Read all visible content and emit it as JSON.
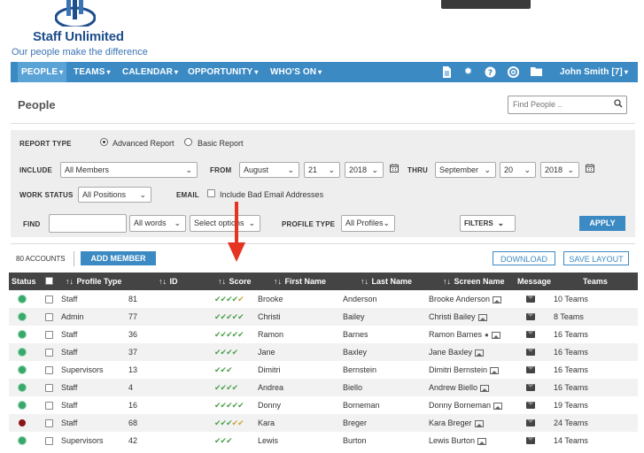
{
  "header": {
    "brand": "Staff Unlimited",
    "tagline": "Our people make the difference"
  },
  "nav": {
    "items": [
      {
        "label": "PEOPLE"
      },
      {
        "label": "TEAMS"
      },
      {
        "label": "CALENDAR"
      },
      {
        "label": "OPPORTUNITY"
      },
      {
        "label": "WHO'S ON"
      }
    ],
    "icons": [
      "document-icon",
      "gear-icon",
      "help-icon",
      "support-icon",
      "folder-icon"
    ],
    "user_label": "John Smith [7]"
  },
  "page": {
    "title": "People",
    "find_placeholder": "Find People .."
  },
  "filters": {
    "report_type_label": "REPORT TYPE",
    "advanced_report": "Advanced Report",
    "basic_report": "Basic Report",
    "include_label": "INCLUDE",
    "include_value": "All Members",
    "from_label": "FROM",
    "from_month": "August",
    "from_day": "21",
    "from_year": "2018",
    "thru_label": "THRU",
    "thru_month": "September",
    "thru_day": "20",
    "thru_year": "2018",
    "work_status_label": "WORK STATUS",
    "work_status_value": "All Positions",
    "email_label": "EMAIL",
    "bad_email_label": "Include Bad Email Addresses",
    "find_label": "FIND",
    "words_value": "All words",
    "options_value": "Select options",
    "profile_type_label": "PROFILE TYPE",
    "profile_type_value": "All Profiles",
    "filters_button": "FILTERS",
    "apply_button": "APPLY"
  },
  "actions": {
    "accounts": "80 ACCOUNTS",
    "add_member": "ADD MEMBER",
    "download": "DOWNLOAD",
    "save_layout": "SAVE LAYOUT"
  },
  "table": {
    "headers": {
      "status": "Status",
      "profile_type": "Profile Type",
      "id": "ID",
      "score": "Score",
      "first_name": "First Name",
      "last_name": "Last Name",
      "screen_name": "Screen Name",
      "message": "Message",
      "teams": "Teams"
    },
    "sort_glyph": "↑↓",
    "rows": [
      {
        "status": "green",
        "profile": "Staff",
        "id": "81",
        "score_green": "✔✔✔✔",
        "score_yellow": "✔",
        "first": "Brooke",
        "last": "Anderson",
        "screen": "Brooke Anderson",
        "person": false,
        "teams": "10 Teams"
      },
      {
        "status": "green",
        "profile": "Admin",
        "id": "77",
        "score_green": "✔✔✔✔✔",
        "score_yellow": "",
        "first": "Christi",
        "last": "Bailey",
        "screen": "Christi Bailey",
        "person": false,
        "teams": "8 Teams"
      },
      {
        "status": "green",
        "profile": "Staff",
        "id": "36",
        "score_green": "✔✔✔✔✔",
        "score_yellow": "",
        "first": "Ramon",
        "last": "Barnes",
        "screen": "Ramon Barnes",
        "person": true,
        "teams": "16 Teams"
      },
      {
        "status": "green",
        "profile": "Staff",
        "id": "37",
        "score_green": "✔✔✔✔",
        "score_yellow": "",
        "first": "Jane",
        "last": "Baxley",
        "screen": "Jane Baxley",
        "person": false,
        "teams": "16 Teams"
      },
      {
        "status": "green",
        "profile": "Supervisors",
        "id": "13",
        "score_green": "✔✔✔",
        "score_yellow": "",
        "first": "Dimitri",
        "last": "Bernstein",
        "screen": "Dimitri Bernstein",
        "person": false,
        "teams": "16 Teams"
      },
      {
        "status": "green",
        "profile": "Staff",
        "id": "4",
        "score_green": "✔✔✔✔",
        "score_yellow": "",
        "first": "Andrea",
        "last": "Biello",
        "screen": "Andrew Biello",
        "person": false,
        "teams": "16 Teams"
      },
      {
        "status": "green",
        "profile": "Staff",
        "id": "16",
        "score_green": "✔✔✔✔✔",
        "score_yellow": "",
        "first": "Donny",
        "last": "Borneman",
        "screen": "Donny Borneman",
        "person": false,
        "teams": "19 Teams"
      },
      {
        "status": "red",
        "profile": "Staff",
        "id": "68",
        "score_green": "✔✔✔",
        "score_yellow": "✔✔",
        "first": "Kara",
        "last": "Breger",
        "screen": "Kara Breger",
        "person": false,
        "teams": "24 Teams"
      },
      {
        "status": "green",
        "profile": "Supervisors",
        "id": "42",
        "score_green": "✔✔✔",
        "score_yellow": "",
        "first": "Lewis",
        "last": "Burton",
        "screen": "Lewis Burton",
        "person": false,
        "teams": "14 Teams"
      }
    ]
  }
}
